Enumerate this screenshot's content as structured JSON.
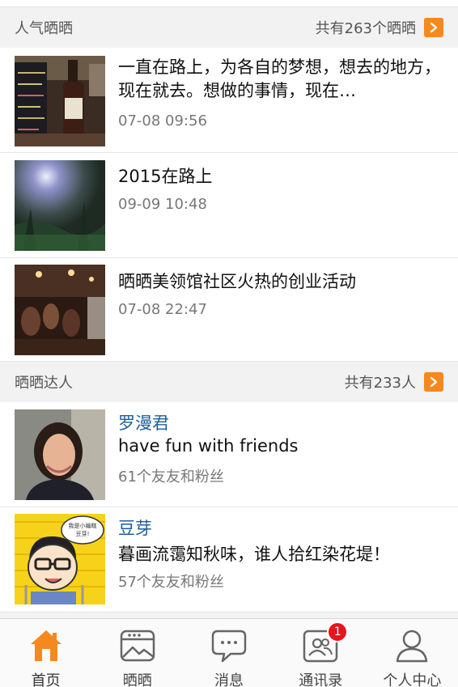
{
  "hot_posts": {
    "title": "人气晒晒",
    "count_label": "共有263个晒晒",
    "items": [
      {
        "title": "一直在路上，为各自的梦想，想去的地方，现在就去。想做的事情，现在…",
        "time": "07-08 09:56",
        "thumb": "wine-bottle-photo"
      },
      {
        "title": "2015在路上",
        "time": "09-09 10:48",
        "thumb": "forest-sunlight-photo"
      },
      {
        "title": "晒晒美领馆社区火热的创业活动",
        "time": "07-08 22:47",
        "thumb": "bar-event-photo"
      }
    ]
  },
  "top_users": {
    "title": "晒晒达人",
    "count_label": "共有233人",
    "items": [
      {
        "name": "罗漫君",
        "signature": "have fun with friends",
        "friends": "61个友友和粉丝",
        "avatar": "woman-portrait"
      },
      {
        "name": "豆芽",
        "signature": "暮画流霭知秋味，谁人拾红染花堤！",
        "friends": "57个友友和粉丝",
        "avatar": "cartoon-boy",
        "avatar_bubble": "我是小编瞎\n豆芽!"
      }
    ]
  },
  "tabbar": {
    "items": [
      {
        "label": "首页",
        "icon": "home-icon",
        "active": true
      },
      {
        "label": "晒晒",
        "icon": "photo-frame-icon"
      },
      {
        "label": "消息",
        "icon": "chat-bubble-icon"
      },
      {
        "label": "通讯录",
        "icon": "contacts-icon",
        "badge": "1"
      },
      {
        "label": "个人中心",
        "icon": "person-icon"
      }
    ]
  },
  "colors": {
    "accent": "#f5891f",
    "link": "#1e5d9c",
    "badge": "#e8141e"
  }
}
